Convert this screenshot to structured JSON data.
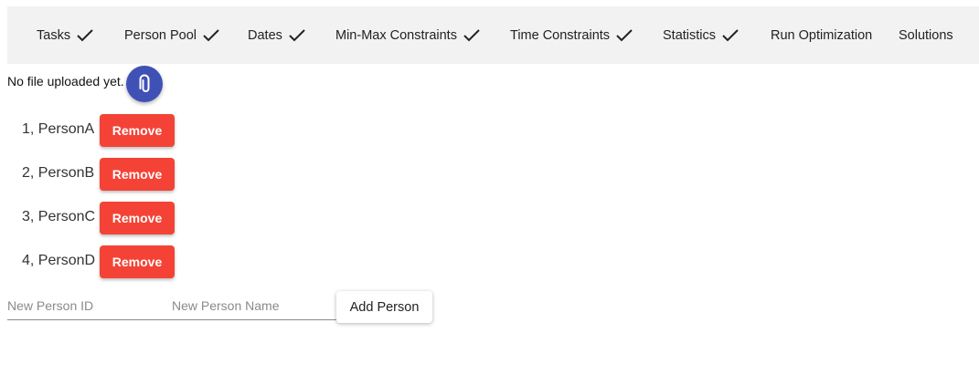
{
  "nav": {
    "items": [
      {
        "label": "Tasks",
        "done": true
      },
      {
        "label": "Person Pool",
        "done": true
      },
      {
        "label": "Dates",
        "done": true
      },
      {
        "label": "Min-Max Constraints",
        "done": true
      },
      {
        "label": "Time Constraints",
        "done": true
      },
      {
        "label": "Statistics",
        "done": true
      },
      {
        "label": "Run Optimization",
        "done": false
      },
      {
        "label": "Solutions",
        "done": false
      }
    ]
  },
  "upload": {
    "status_text": "No file uploaded yet.",
    "button_icon": "paperclip-icon"
  },
  "persons": [
    {
      "label": "1, PersonA",
      "remove_label": "Remove"
    },
    {
      "label": "2, PersonB",
      "remove_label": "Remove"
    },
    {
      "label": "3, PersonC",
      "remove_label": "Remove"
    },
    {
      "label": "4, PersonD",
      "remove_label": "Remove"
    }
  ],
  "form": {
    "id_placeholder": "New Person ID",
    "name_placeholder": "New Person Name",
    "id_value": "",
    "name_value": "",
    "add_label": "Add Person"
  },
  "colors": {
    "remove": "#f44336",
    "fab": "#3f51b5",
    "nav_bg": "#f2f2f2"
  }
}
